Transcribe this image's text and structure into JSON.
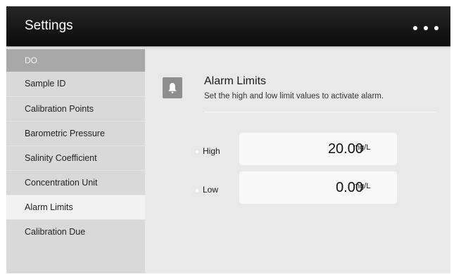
{
  "header": {
    "title": "Settings",
    "more_icon": "more-horizontal-icon"
  },
  "sidebar": {
    "group_label": "DO",
    "items": [
      {
        "label": "Sample ID",
        "active": false
      },
      {
        "label": "Calibration Points",
        "active": false
      },
      {
        "label": "Barometric Pressure",
        "active": false
      },
      {
        "label": "Salinity Coefficient",
        "active": false
      },
      {
        "label": "Concentration Unit",
        "active": false
      },
      {
        "label": "Alarm Limits",
        "active": true
      },
      {
        "label": "Calibration Due",
        "active": false
      }
    ]
  },
  "main": {
    "icon": "bell-icon",
    "title": "Alarm Limits",
    "subtitle": "Set the high and low limit values to activate alarm.",
    "fields": [
      {
        "label": "High",
        "value": "20.00",
        "unit": "mg/L"
      },
      {
        "label": "Low",
        "value": "0.00",
        "unit": "mg/L"
      }
    ]
  },
  "colors": {
    "titlebar": "#111111",
    "sidebar_group": "#a8a8a8",
    "sidebar": "#d9d9d9",
    "active_item": "#f2f2f2",
    "content_bg": "#e9e9e9"
  }
}
